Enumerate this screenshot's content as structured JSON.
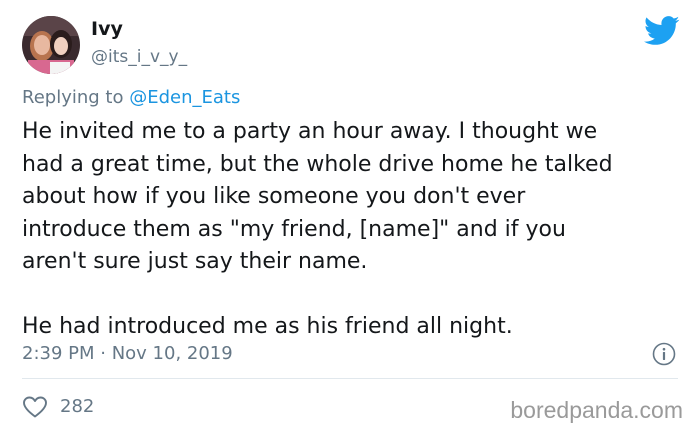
{
  "author": {
    "display_name": "Ivy",
    "handle": "@its_i_v_y_"
  },
  "reply": {
    "prefix": "Replying to ",
    "mention": "@Eden_Eats"
  },
  "tweet": {
    "paragraph_1": "He invited me to a party an hour away. I thought we\nhad a great time, but the whole drive home he talked\nabout how if you like someone you don't ever\nintroduce them as \"my friend, [name]\" and if you\naren't sure just say their name.",
    "paragraph_2": "He had introduced me as his friend all night.",
    "timestamp": "2:39 PM · Nov 10, 2019",
    "like_count": "282"
  },
  "icons": {
    "platform": "twitter-bird-icon",
    "info": "info-icon",
    "like": "heart-icon"
  },
  "colors": {
    "brand_blue": "#1da1f2",
    "mention_blue": "#1b95e0",
    "secondary_text": "#657786",
    "primary_text": "#14171a",
    "divider": "#e1e8ed"
  },
  "watermark": "boredpanda.com"
}
